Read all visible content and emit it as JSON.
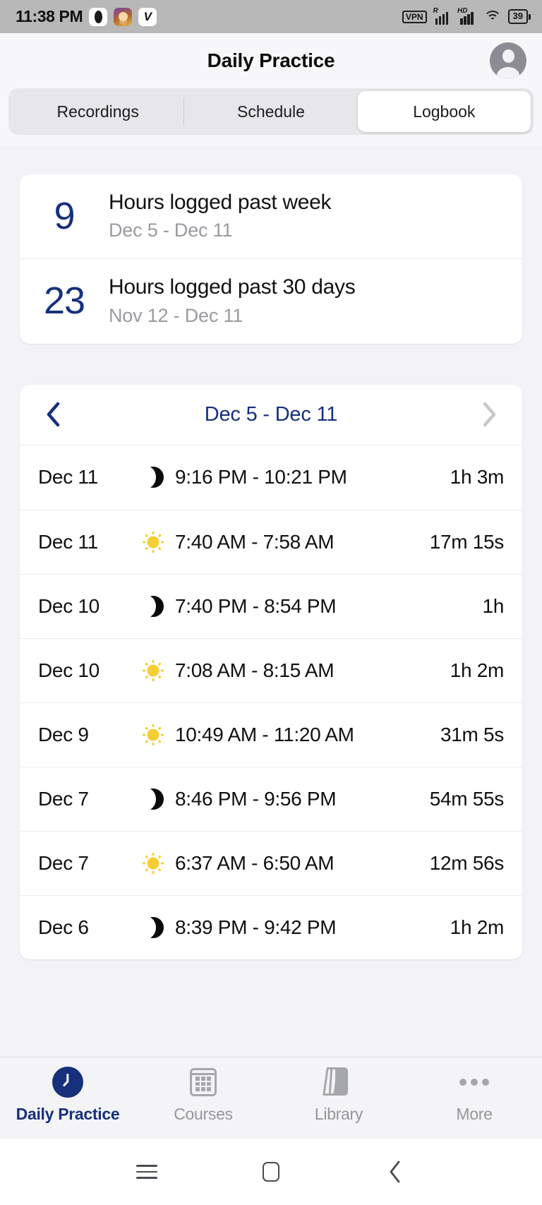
{
  "statusbar": {
    "time": "11:38 PM",
    "app_icons": [
      "dark-capsule-app-icon",
      "character-avatar-app-icon",
      "v-letter-app-icon"
    ],
    "v_glyph": "V",
    "vpn_label": "VPN",
    "roaming_label": "R",
    "hd_label": "HD",
    "battery_level": "39"
  },
  "header": {
    "title": "Daily Practice",
    "avatar": "account-avatar"
  },
  "tabs": {
    "items": [
      {
        "label": "Recordings",
        "active": false
      },
      {
        "label": "Schedule",
        "active": false
      },
      {
        "label": "Logbook",
        "active": true
      }
    ]
  },
  "stats": [
    {
      "value": "9",
      "label": "Hours logged past week",
      "range": "Dec 5 - Dec 11"
    },
    {
      "value": "23",
      "label": "Hours logged past 30 days",
      "range": "Nov 12 - Dec 11"
    }
  ],
  "weeknav": {
    "prev_icon": "chevron-left-icon",
    "next_icon": "chevron-right-icon",
    "range": "Dec 5 - Dec 11",
    "prev_enabled": true,
    "next_enabled": false
  },
  "log_entries": [
    {
      "date": "Dec 11",
      "icon": "moon",
      "time": "9:16 PM - 10:21 PM",
      "duration": "1h 3m"
    },
    {
      "date": "Dec 11",
      "icon": "sun",
      "time": "7:40 AM - 7:58 AM",
      "duration": "17m 15s"
    },
    {
      "date": "Dec 10",
      "icon": "moon",
      "time": "7:40 PM - 8:54 PM",
      "duration": "1h"
    },
    {
      "date": "Dec 10",
      "icon": "sun",
      "time": "7:08 AM - 8:15 AM",
      "duration": "1h 2m"
    },
    {
      "date": "Dec 9",
      "icon": "sun",
      "time": "10:49 AM - 11:20 AM",
      "duration": "31m 5s"
    },
    {
      "date": "Dec 7",
      "icon": "moon",
      "time": "8:46 PM - 9:56 PM",
      "duration": "54m 55s"
    },
    {
      "date": "Dec 7",
      "icon": "sun",
      "time": "6:37 AM - 6:50 AM",
      "duration": "12m 56s"
    },
    {
      "date": "Dec 6",
      "icon": "moon",
      "time": "8:39 PM - 9:42 PM",
      "duration": "1h 2m"
    }
  ],
  "bottom_nav": [
    {
      "label": "Daily Practice",
      "icon": "clock-icon",
      "active": true
    },
    {
      "label": "Courses",
      "icon": "calendar-icon",
      "active": false
    },
    {
      "label": "Library",
      "icon": "books-icon",
      "active": false
    },
    {
      "label": "More",
      "icon": "ellipsis-icon",
      "active": false
    }
  ],
  "android_nav": {
    "menu": "recents-menu-icon",
    "home": "home-icon",
    "back": "back-icon"
  },
  "colors": {
    "accent_navy": "#16307c",
    "sun_yellow": "#f5ce36",
    "muted_gray": "#9a9aa0",
    "page_bg": "#f2f2f7"
  }
}
